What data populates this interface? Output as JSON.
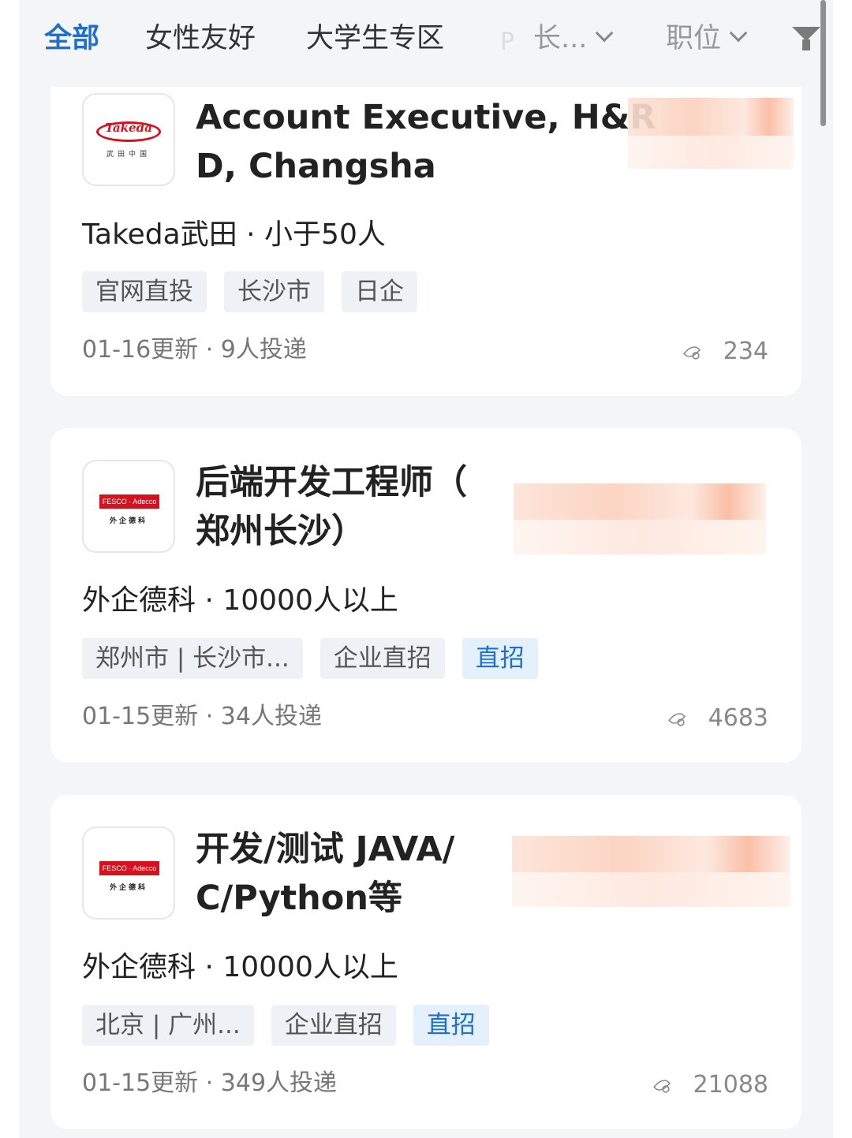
{
  "filter_bar": {
    "tabs": [
      {
        "label": "全部",
        "active": true
      },
      {
        "label": "女性友好",
        "active": false
      },
      {
        "label": "大学生专区",
        "active": false
      }
    ],
    "faded_text": "P",
    "city_dropdown": "长...",
    "position_dropdown": "职位",
    "filter_icon": "filter-funnel-icon"
  },
  "jobs": [
    {
      "title": "Account Executive, H&R\nD, Changsha",
      "logo": {
        "type": "takeda",
        "word": "Takeda",
        "sub": "武田中国"
      },
      "company_line": "Takeda武田 · 小于50人",
      "tags": [
        {
          "label": "官网直投",
          "highlight": false
        },
        {
          "label": "长沙市",
          "highlight": false
        },
        {
          "label": "日企",
          "highlight": false
        }
      ],
      "meta": "01-16更新 · 9人投递",
      "views": "234"
    },
    {
      "title": "后端开发工程师（\n郑州长沙）",
      "logo": {
        "type": "fesco",
        "word": "FESCO · Adecco",
        "sub": "外企德科"
      },
      "company_line": "外企德科 · 10000人以上",
      "tags": [
        {
          "label": "郑州市 | 长沙市...",
          "highlight": false
        },
        {
          "label": "企业直招",
          "highlight": false
        },
        {
          "label": "直招",
          "highlight": true
        }
      ],
      "meta": "01-15更新 · 34人投递",
      "views": "4683"
    },
    {
      "title": "开发/测试 JAVA/\nC/Python等",
      "logo": {
        "type": "fesco",
        "word": "FESCO · Adecco",
        "sub": "外企德科"
      },
      "company_line": "外企德科 · 10000人以上",
      "tags": [
        {
          "label": "北京 | 广州...",
          "highlight": false
        },
        {
          "label": "企业直招",
          "highlight": false
        },
        {
          "label": "直招",
          "highlight": true
        }
      ],
      "meta": "01-15更新 · 349人投递",
      "views": "21088"
    }
  ],
  "colors": {
    "accent": "#1f6fd0",
    "page_bg": "#f4f5f7",
    "card_bg": "#ffffff",
    "tag_bg": "#eef2f7",
    "brand_red": "#d6101e"
  }
}
